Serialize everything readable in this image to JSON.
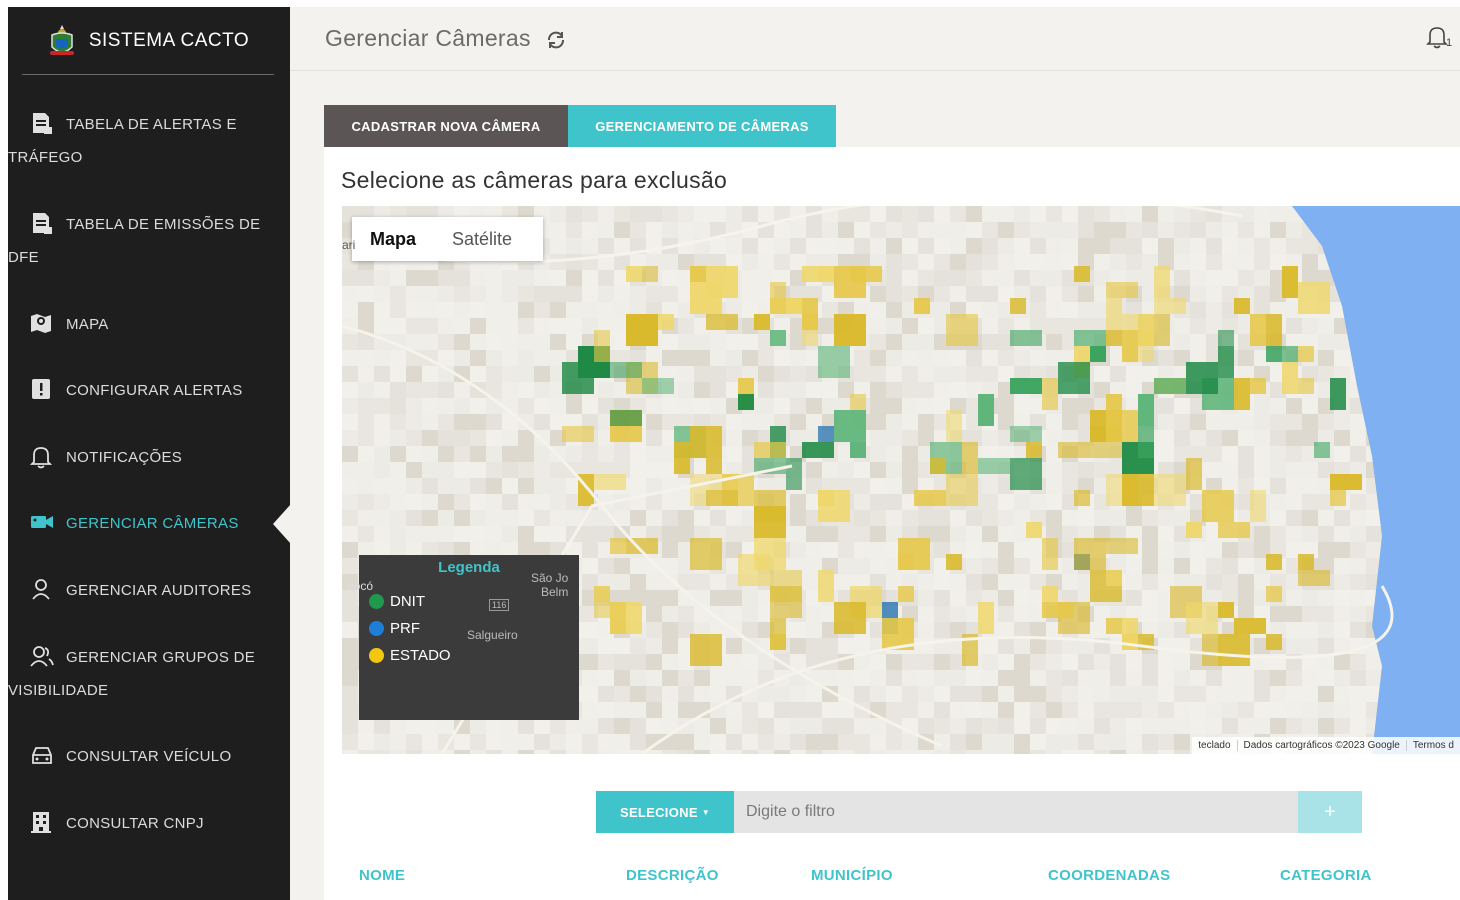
{
  "sidebar": {
    "brand": "SISTEMA CACTO",
    "items": [
      {
        "label": "TABELA DE ALERTAS E",
        "label2": "TRÁFEGO",
        "icon": "document-icon"
      },
      {
        "label": "TABELA DE EMISSÕES DE",
        "label2": "DFE",
        "icon": "document-icon"
      },
      {
        "label": "MAPA",
        "icon": "map-pin-icon"
      },
      {
        "label": "CONFIGURAR ALERTAS",
        "icon": "alert-icon"
      },
      {
        "label": "NOTIFICAÇÕES",
        "icon": "bell-icon"
      },
      {
        "label": "GERENCIAR CÂMERAS",
        "icon": "video-camera-icon",
        "active": true
      },
      {
        "label": "GERENCIAR AUDITORES",
        "icon": "user-icon"
      },
      {
        "label": "GERENCIAR GRUPOS DE",
        "label2": "VISIBILIDADE",
        "icon": "users-icon"
      },
      {
        "label": "CONSULTAR VEÍCULO",
        "icon": "car-icon"
      },
      {
        "label": "CONSULTAR CNPJ",
        "icon": "building-icon"
      }
    ]
  },
  "header": {
    "title": "Gerenciar Câmeras",
    "notification_count": "1"
  },
  "tabs": [
    {
      "label": "CADASTRAR NOVA CÂMERA"
    },
    {
      "label": "GERENCIAMENTO DE CÂMERAS"
    }
  ],
  "card": {
    "title": "Selecione as câmeras para exclusão"
  },
  "map": {
    "type_selected": "Mapa",
    "type_other": "Satélite",
    "legend": {
      "title": "Legenda",
      "items": [
        {
          "label": "DNIT",
          "color": "#1f9a4c"
        },
        {
          "label": "PRF",
          "color": "#1f7fd6"
        },
        {
          "label": "ESTADO",
          "color": "#f2c80f"
        }
      ]
    },
    "place_labels": [
      "São Jo",
      "Belm",
      "Salgueiro",
      "116",
      "dócó",
      "ari"
    ],
    "attribution": {
      "keyboard": "teclado",
      "data": "Dados cartográficos ©2023 Google",
      "terms": "Termos d"
    }
  },
  "filter": {
    "select_label": "SELECIONE",
    "placeholder": "Digite o filtro",
    "add_label": "+"
  },
  "table": {
    "headers": [
      "NOME",
      "DESCRIÇÃO",
      "MUNICÍPIO",
      "COORDENADAS",
      "CATEGORIA"
    ]
  },
  "colors": {
    "accent": "#40c4cc",
    "sidebar_bg": "#1e1e1e",
    "tab_dark": "#5c5555"
  }
}
